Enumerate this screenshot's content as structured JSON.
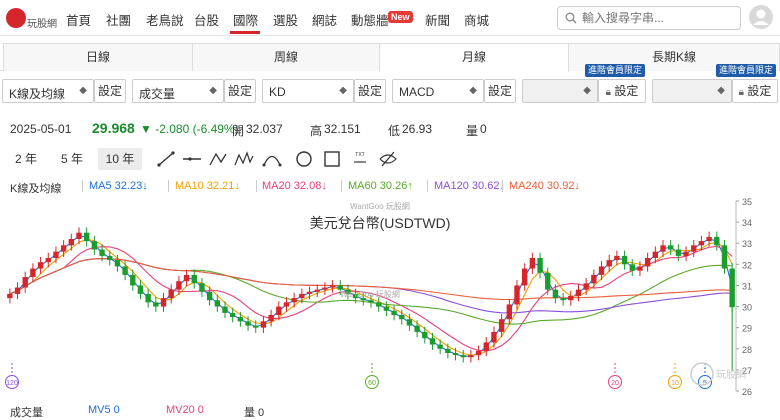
{
  "brand": {
    "logo_text": "玩股網",
    "accent": "#d4262b"
  },
  "nav": {
    "items": [
      "首頁",
      "社團",
      "老鳥說",
      "台股",
      "國際",
      "選股",
      "網誌",
      "動態牆",
      "新聞",
      "商城"
    ],
    "active": "國際",
    "new_badge": "New"
  },
  "search": {
    "placeholder": "輸入搜尋字串..."
  },
  "tabs": [
    "日線",
    "周線",
    "月線",
    "長期K線"
  ],
  "active_tab": "月線",
  "selects": [
    {
      "label": "K線及均線",
      "button": "設定"
    },
    {
      "label": "成交量",
      "button": "設定"
    },
    {
      "label": "KD",
      "button": "設定"
    },
    {
      "label": "MACD",
      "button": "設定"
    },
    {
      "label": "",
      "button": "設定",
      "vip": "進階會員限定",
      "locked": true
    },
    {
      "label": "",
      "button": "設定",
      "vip": "進階會員限定",
      "locked": true
    }
  ],
  "quote": {
    "date": "2025-05-01",
    "price": "29.968",
    "change": "▼ -2.080 (-6.49%)",
    "open_label": "開",
    "open": "32.037",
    "high_label": "高",
    "high": "32.151",
    "low_label": "低",
    "low": "26.93",
    "vol_label": "量",
    "vol": "0"
  },
  "ranges": [
    "2 年",
    "5 年",
    "10 年"
  ],
  "active_range": "10 年",
  "tools": [
    "line-tool-icon",
    "horizontal-line-tool-icon",
    "wave-tool-icon",
    "multi-wave-tool-icon",
    "arc-tool-icon",
    "circle-tool-icon",
    "rectangle-tool-icon",
    "text-tool-icon",
    "hide-tool-icon"
  ],
  "legend": {
    "title": "K線及均線",
    "items": [
      {
        "label": "MA5 32.23↓",
        "color": "#1f6fd6"
      },
      {
        "label": "MA10 32.21↓",
        "color": "#f0a000"
      },
      {
        "label": "MA20 32.08↓",
        "color": "#e8407a"
      },
      {
        "label": "MA60 30.26↑",
        "color": "#5aaa2a"
      },
      {
        "label": "MA120 30.62↓",
        "color": "#8a4fd6"
      },
      {
        "label": "MA240 30.92↓",
        "color": "#e8603a"
      }
    ]
  },
  "chart_data": {
    "type": "candlestick",
    "title": "美元兌台幣(USDTWD)",
    "watermark": "WantGoo 玩股網",
    "ylim": [
      26,
      35
    ],
    "y_ticks": [
      "35",
      "34",
      "33",
      "32",
      "31",
      "30",
      "29",
      "28",
      "27",
      "26"
    ],
    "up_color": "#d4262b",
    "down_color": "#1a9c2e",
    "closes": [
      30.6,
      30.9,
      31.4,
      31.8,
      32.1,
      32.3,
      32.6,
      32.9,
      33.2,
      33.5,
      33.1,
      32.7,
      32.4,
      32.2,
      31.9,
      31.5,
      31.0,
      30.6,
      30.2,
      30.0,
      30.4,
      30.8,
      31.2,
      31.5,
      31.1,
      30.7,
      30.3,
      30.0,
      29.7,
      29.5,
      29.3,
      29.1,
      29.0,
      29.3,
      29.6,
      30.0,
      30.2,
      30.4,
      30.6,
      30.7,
      30.8,
      30.9,
      31.0,
      30.8,
      30.6,
      30.4,
      30.3,
      30.2,
      30.0,
      29.8,
      29.6,
      29.4,
      29.1,
      28.8,
      28.5,
      28.2,
      28.0,
      27.8,
      27.7,
      27.6,
      27.7,
      27.9,
      28.3,
      28.8,
      29.4,
      30.1,
      31.0,
      31.8,
      32.3,
      31.6,
      30.8,
      30.4,
      30.3,
      30.5,
      30.8,
      31.1,
      31.5,
      31.9,
      32.2,
      32.4,
      32.0,
      31.7,
      31.9,
      32.3,
      32.6,
      32.9,
      32.7,
      32.4,
      32.6,
      32.9,
      33.1,
      33.3,
      32.9,
      31.8,
      29.968
    ],
    "series": [
      {
        "name": "MA5",
        "color": "#1f6fd6"
      },
      {
        "name": "MA10",
        "color": "#f0a000"
      },
      {
        "name": "MA20",
        "color": "#e8407a"
      },
      {
        "name": "MA60",
        "color": "#5aaa2a"
      },
      {
        "name": "MA120",
        "color": "#8a4fd6"
      },
      {
        "name": "MA240",
        "color": "#e8603a"
      }
    ],
    "markers": [
      "120",
      "60",
      "20",
      "10",
      "5"
    ]
  },
  "volume": {
    "title": "成交量",
    "ma5": "MV5 0",
    "ma20": "MV20 0",
    "vol": "量 0",
    "ma5_color": "#1f6fd6",
    "ma20_color": "#e8407a"
  }
}
